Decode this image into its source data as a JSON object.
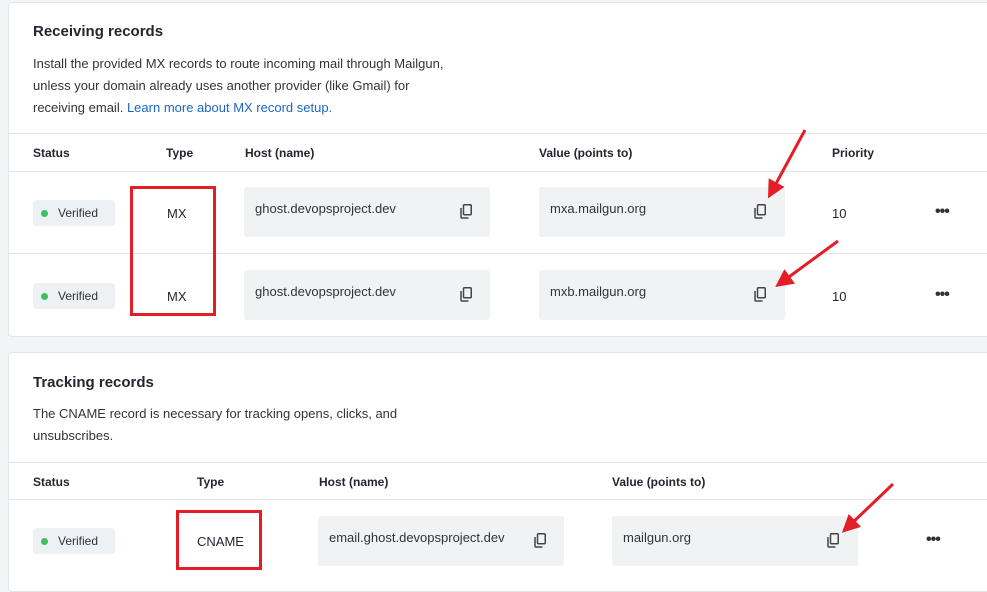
{
  "receiving": {
    "title": "Receiving records",
    "desc_line1": "Install the provided MX records to route incoming mail through Mailgun,",
    "desc_line2": "unless your domain already uses another provider (like Gmail) for",
    "desc_line3": "receiving email.",
    "link": "Learn more about MX record setup.",
    "headers": {
      "status": "Status",
      "type": "Type",
      "host": "Host (name)",
      "value": "Value (points to)",
      "priority": "Priority"
    },
    "rows": [
      {
        "status": "Verified",
        "type": "MX",
        "host": "ghost.devopsproject.dev",
        "value": "mxa.mailgun.org",
        "priority": "10",
        "more": "•••"
      },
      {
        "status": "Verified",
        "type": "MX",
        "host": "ghost.devopsproject.dev",
        "value": "mxb.mailgun.org",
        "priority": "10",
        "more": "•••"
      }
    ]
  },
  "tracking": {
    "title": "Tracking records",
    "desc_line1": "The CNAME record is necessary for tracking opens, clicks, and",
    "desc_line2": "unsubscribes.",
    "headers": {
      "status": "Status",
      "type": "Type",
      "host": "Host (name)",
      "value": "Value (points to)"
    },
    "rows": [
      {
        "status": "Verified",
        "type": "CNAME",
        "host": "email.ghost.devopsproject.dev",
        "value": "mailgun.org",
        "more": "•••"
      }
    ]
  },
  "colors": {
    "accent_link": "#1b66c9",
    "verified_dot": "#3dbf63",
    "annotation_red": "#e41e26"
  },
  "icons": {
    "copy": "copy-icon",
    "more": "more-horizontal-icon",
    "status": "status-dot-icon"
  }
}
